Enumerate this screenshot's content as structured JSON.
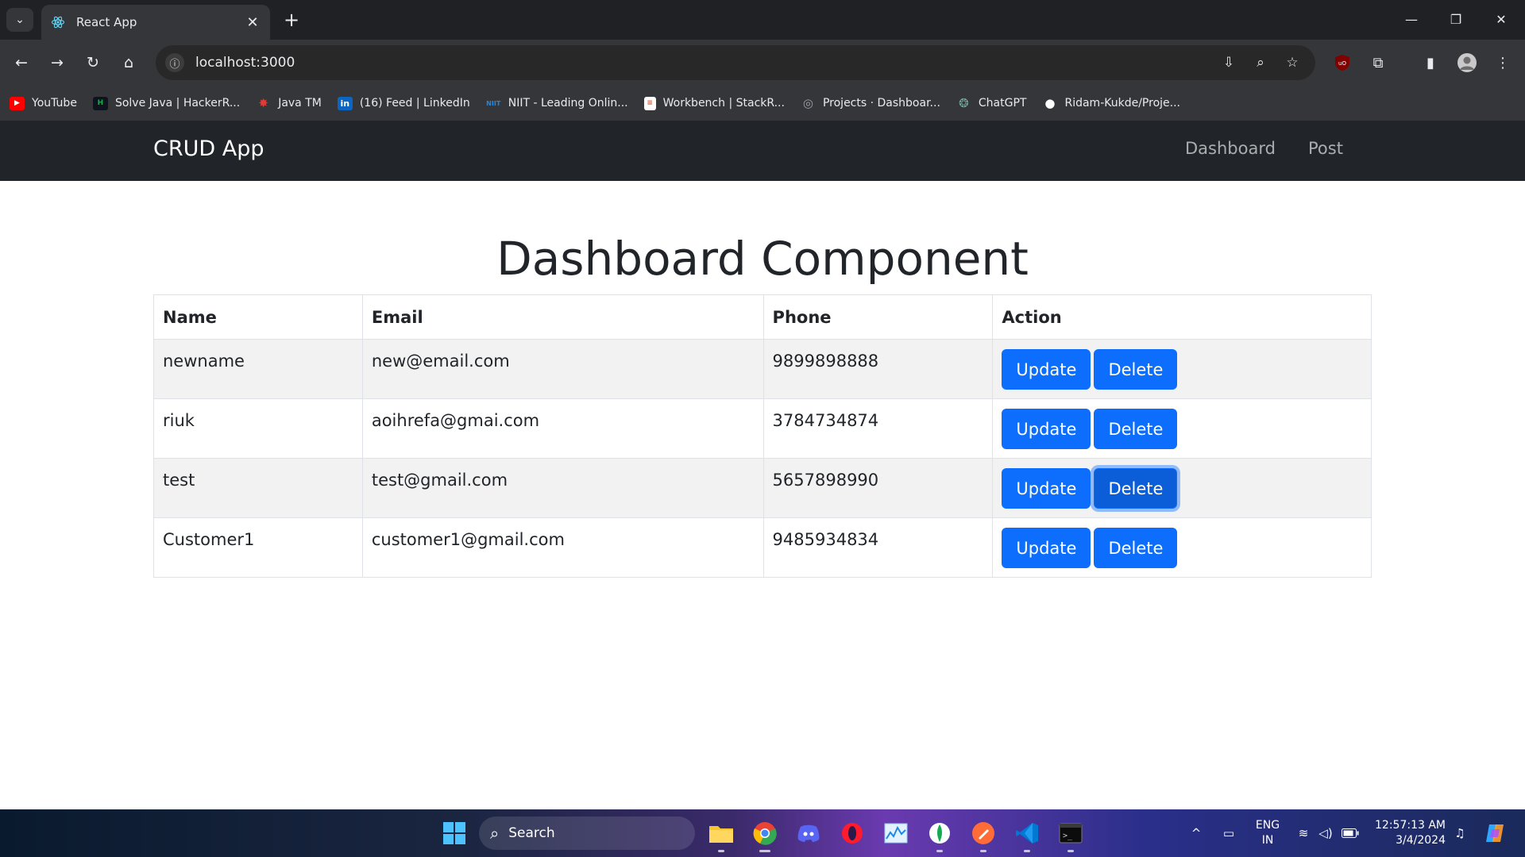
{
  "browser": {
    "tab_title": "React App",
    "url": "localhost:3000",
    "bookmarks": [
      {
        "label": "YouTube",
        "icon": "youtube-icon",
        "color": "#ff0000"
      },
      {
        "label": "Solve Java | HackerR...",
        "icon": "hackerrank-icon",
        "color": "#1ba94c"
      },
      {
        "label": "Java TM",
        "icon": "java-icon",
        "color": "#e53935"
      },
      {
        "label": "(16) Feed | LinkedIn",
        "icon": "linkedin-icon",
        "color": "#0a66c2"
      },
      {
        "label": "NIIT - Leading Onlin...",
        "icon": "niit-icon",
        "color": "#1565c0"
      },
      {
        "label": "Workbench | StackR...",
        "icon": "stackroute-icon",
        "color": "#f4511e"
      },
      {
        "label": "Projects · Dashboar...",
        "icon": "globe-icon",
        "color": "#9aa0a6"
      },
      {
        "label": "ChatGPT",
        "icon": "chatgpt-icon",
        "color": "#74aa9c"
      },
      {
        "label": "Ridam-Kukde/Proje...",
        "icon": "github-icon",
        "color": "#ffffff"
      }
    ]
  },
  "app": {
    "brand": "CRUD App",
    "nav": {
      "dashboard": "Dashboard",
      "post": "Post"
    },
    "title": "Dashboard Component",
    "table": {
      "headers": {
        "name": "Name",
        "email": "Email",
        "phone": "Phone",
        "action": "Action"
      },
      "rows": [
        {
          "name": "newname",
          "email": "new@email.com",
          "phone": "9899898888"
        },
        {
          "name": "riuk",
          "email": "aoihrefa@gmai.com",
          "phone": "3784734874"
        },
        {
          "name": "test",
          "email": "test@gmail.com",
          "phone": "5657898990"
        },
        {
          "name": "Customer1",
          "email": "customer1@gmail.com",
          "phone": "9485934834"
        }
      ],
      "update_label": "Update",
      "delete_label": "Delete"
    },
    "accent_color": "#0d6efd"
  },
  "taskbar": {
    "search_label": "Search",
    "lang_line1": "ENG",
    "lang_line2": "IN",
    "time": "12:57:13 AM",
    "date": "3/4/2024"
  }
}
